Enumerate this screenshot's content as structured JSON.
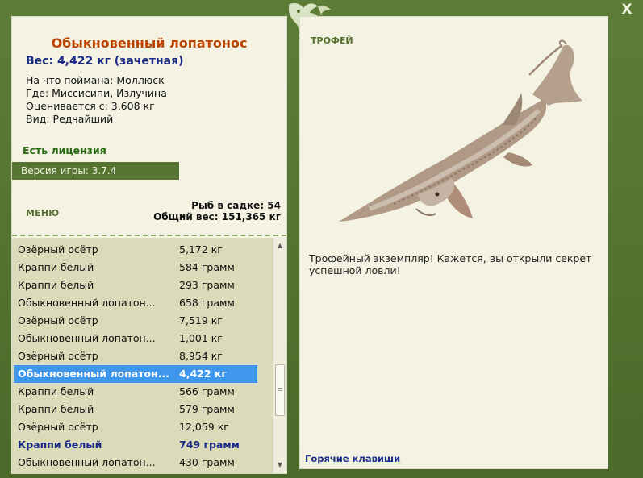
{
  "window": {
    "close_label": "X"
  },
  "fish": {
    "name": "Обыкновенный лопатонос",
    "weight_line": "Вес: 4,422 кг (зачетная)",
    "details": [
      "На что поймана: Моллюск",
      "Где: Миссисипи, Излучина",
      "Оценивается с: 3,608 кг",
      "Вид: Редчайший"
    ]
  },
  "license": "Есть лицензия",
  "version": "Версия игры: 3.7.4",
  "menu_label": "МЕНЮ",
  "stats": {
    "keepnet": "Рыб в садке: 54",
    "total_weight": "Общий вес: 151,365 кг"
  },
  "catch_list": [
    {
      "name": "Озёрный осётр",
      "weight": "5,172 кг",
      "state": "normal"
    },
    {
      "name": "Краппи белый",
      "weight": "584 грамм",
      "state": "normal"
    },
    {
      "name": "Краппи белый",
      "weight": "293 грамм",
      "state": "normal"
    },
    {
      "name": "Обыкновенный лопатон...",
      "weight": "658 грамм",
      "state": "normal"
    },
    {
      "name": "Озёрный осётр",
      "weight": "7,519 кг",
      "state": "normal"
    },
    {
      "name": "Обыкновенный лопатон...",
      "weight": "1,001 кг",
      "state": "normal"
    },
    {
      "name": "Озёрный осётр",
      "weight": "8,954 кг",
      "state": "normal"
    },
    {
      "name": "Обыкновенный лопатон...",
      "weight": "4,422 кг",
      "state": "selected"
    },
    {
      "name": "Краппи белый",
      "weight": "566 грамм",
      "state": "normal"
    },
    {
      "name": "Краппи белый",
      "weight": "579 грамм",
      "state": "normal"
    },
    {
      "name": "Озёрный осётр",
      "weight": "12,059 кг",
      "state": "normal"
    },
    {
      "name": "Краппи белый",
      "weight": "749 грамм",
      "state": "bold"
    },
    {
      "name": "Обыкновенный лопатон...",
      "weight": "430 грамм",
      "state": "normal"
    }
  ],
  "trophy_label": "ТРОФЕЙ",
  "description": "Трофейный экземпляр! Кажется, вы открыли секрет успешной ловли!",
  "hotkeys_label": "Горячие клавиши",
  "icons": {
    "close": "close-icon",
    "emblem": "fish-emblem-icon",
    "scroll_up": "arrow-up-icon",
    "scroll_down": "arrow-down-icon",
    "trophy_fish": "paddlefish-image"
  },
  "colors": {
    "frame": "#4e6a2e",
    "panel": "#f4f3e3",
    "title": "#bd4400",
    "weight": "#1a2a86",
    "license": "#2a6a13",
    "selection": "#3e96ed",
    "list_bg": "#dcdbb9"
  }
}
